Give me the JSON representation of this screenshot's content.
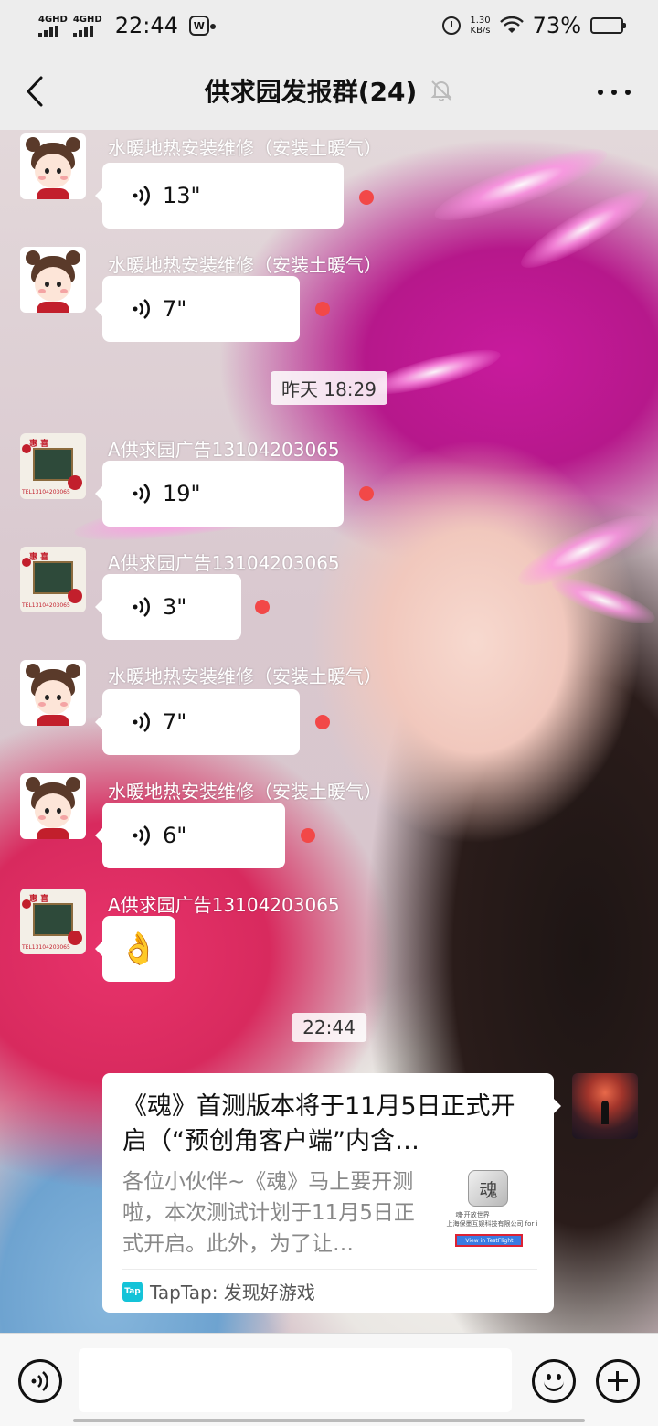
{
  "status_bar": {
    "network1": "4GHD",
    "network2": "4GHD",
    "time": "22:44",
    "speed_value": "1.30",
    "speed_unit": "KB/s",
    "battery": "73%",
    "battery_level": 0.73
  },
  "header": {
    "title": "供求园发报群(24)",
    "back_icon": "chevron-left-icon",
    "mute_icon": "bell-off-icon",
    "more_icon": "more-dots-icon"
  },
  "messages": [
    {
      "sender": "水暖地热安装维修（安装土暖气）",
      "duration": "13\"",
      "avatar": "cartoon-girl"
    },
    {
      "sender": "水暖地热安装维修（安装土暖气）",
      "duration": "7\"",
      "avatar": "cartoon-girl"
    },
    {
      "sender": "A供求园广告13104203065",
      "duration": "19\"",
      "avatar": "ad-board"
    },
    {
      "sender": "A供求园广告13104203065",
      "duration": "3\"",
      "avatar": "ad-board"
    },
    {
      "sender": "水暖地热安装维修（安装土暖气）",
      "duration": "7\"",
      "avatar": "cartoon-girl"
    },
    {
      "sender": "水暖地热安装维修（安装土暖气）",
      "duration": "6\"",
      "avatar": "cartoon-girl"
    },
    {
      "sender": "A供求园广告13104203065",
      "emoji": "👌",
      "avatar": "ad-board"
    }
  ],
  "timestamps": {
    "first": "昨天 18:29",
    "second": "22:44"
  },
  "link_card": {
    "title": "《魂》首测版本将于11月5日正式开启（“预创角客户端”内含…",
    "description": "各位小伙伴~《魂》马上要开测啦，本次测试计划于11月5日正式开启。此外，为了让…",
    "source": "TapTap: 发现好游戏",
    "source_icon_text": "Tap",
    "thumb_logo_text": "魂",
    "thumb_caption_1": "魂·开放世界",
    "thumb_caption_2": "上海保墨互娱科技有限公司 for i",
    "thumb_button": "View in TestFlight"
  },
  "input_bar": {
    "placeholder": "",
    "voice_icon": "voice-toggle-icon",
    "emoji_icon": "emoji-icon",
    "plus_icon": "plus-icon"
  },
  "colors": {
    "unread_dot": "#f24848",
    "bubble": "#ffffff",
    "chrome": "#ededed"
  }
}
